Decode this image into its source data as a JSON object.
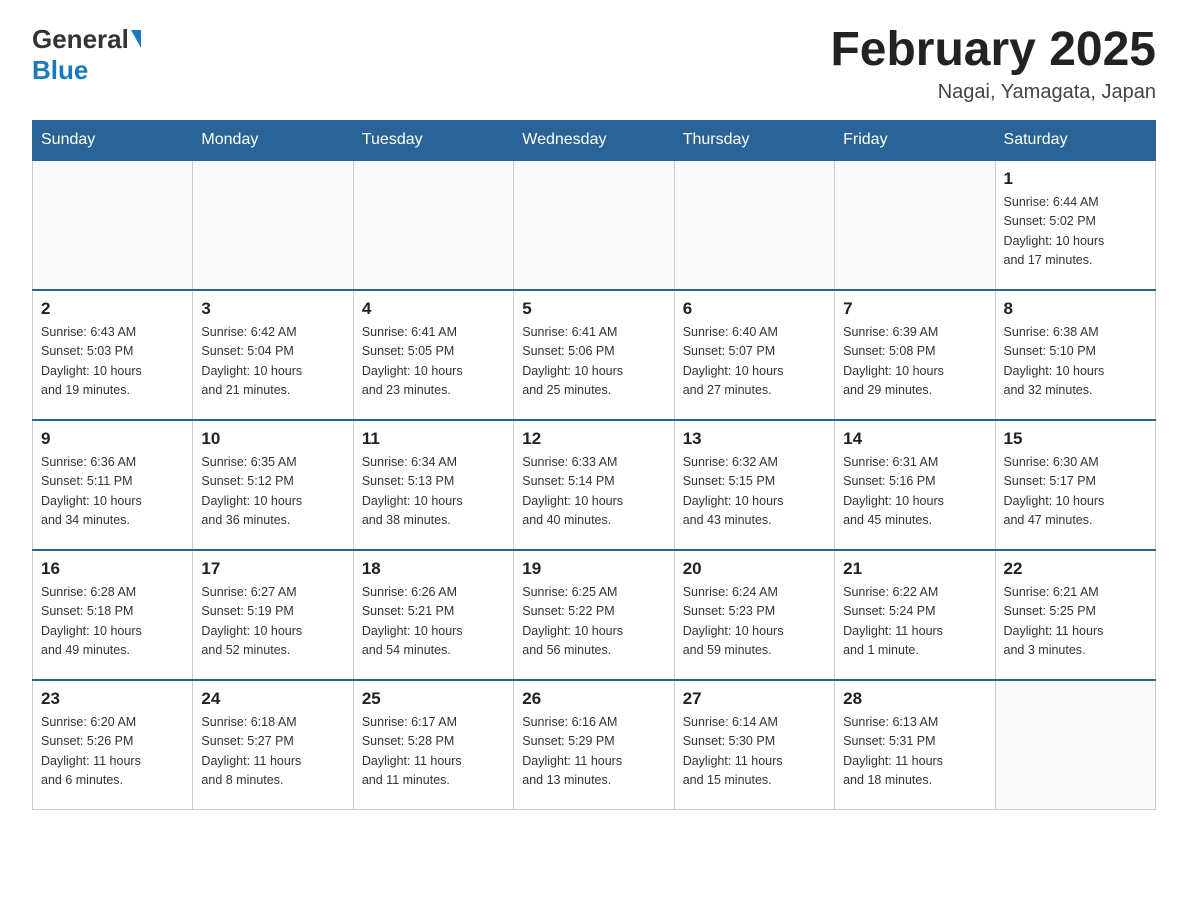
{
  "logo": {
    "general": "General",
    "blue": "Blue"
  },
  "header": {
    "title": "February 2025",
    "location": "Nagai, Yamagata, Japan"
  },
  "weekdays": [
    "Sunday",
    "Monday",
    "Tuesday",
    "Wednesday",
    "Thursday",
    "Friday",
    "Saturday"
  ],
  "weeks": [
    [
      {
        "day": "",
        "info": ""
      },
      {
        "day": "",
        "info": ""
      },
      {
        "day": "",
        "info": ""
      },
      {
        "day": "",
        "info": ""
      },
      {
        "day": "",
        "info": ""
      },
      {
        "day": "",
        "info": ""
      },
      {
        "day": "1",
        "info": "Sunrise: 6:44 AM\nSunset: 5:02 PM\nDaylight: 10 hours\nand 17 minutes."
      }
    ],
    [
      {
        "day": "2",
        "info": "Sunrise: 6:43 AM\nSunset: 5:03 PM\nDaylight: 10 hours\nand 19 minutes."
      },
      {
        "day": "3",
        "info": "Sunrise: 6:42 AM\nSunset: 5:04 PM\nDaylight: 10 hours\nand 21 minutes."
      },
      {
        "day": "4",
        "info": "Sunrise: 6:41 AM\nSunset: 5:05 PM\nDaylight: 10 hours\nand 23 minutes."
      },
      {
        "day": "5",
        "info": "Sunrise: 6:41 AM\nSunset: 5:06 PM\nDaylight: 10 hours\nand 25 minutes."
      },
      {
        "day": "6",
        "info": "Sunrise: 6:40 AM\nSunset: 5:07 PM\nDaylight: 10 hours\nand 27 minutes."
      },
      {
        "day": "7",
        "info": "Sunrise: 6:39 AM\nSunset: 5:08 PM\nDaylight: 10 hours\nand 29 minutes."
      },
      {
        "day": "8",
        "info": "Sunrise: 6:38 AM\nSunset: 5:10 PM\nDaylight: 10 hours\nand 32 minutes."
      }
    ],
    [
      {
        "day": "9",
        "info": "Sunrise: 6:36 AM\nSunset: 5:11 PM\nDaylight: 10 hours\nand 34 minutes."
      },
      {
        "day": "10",
        "info": "Sunrise: 6:35 AM\nSunset: 5:12 PM\nDaylight: 10 hours\nand 36 minutes."
      },
      {
        "day": "11",
        "info": "Sunrise: 6:34 AM\nSunset: 5:13 PM\nDaylight: 10 hours\nand 38 minutes."
      },
      {
        "day": "12",
        "info": "Sunrise: 6:33 AM\nSunset: 5:14 PM\nDaylight: 10 hours\nand 40 minutes."
      },
      {
        "day": "13",
        "info": "Sunrise: 6:32 AM\nSunset: 5:15 PM\nDaylight: 10 hours\nand 43 minutes."
      },
      {
        "day": "14",
        "info": "Sunrise: 6:31 AM\nSunset: 5:16 PM\nDaylight: 10 hours\nand 45 minutes."
      },
      {
        "day": "15",
        "info": "Sunrise: 6:30 AM\nSunset: 5:17 PM\nDaylight: 10 hours\nand 47 minutes."
      }
    ],
    [
      {
        "day": "16",
        "info": "Sunrise: 6:28 AM\nSunset: 5:18 PM\nDaylight: 10 hours\nand 49 minutes."
      },
      {
        "day": "17",
        "info": "Sunrise: 6:27 AM\nSunset: 5:19 PM\nDaylight: 10 hours\nand 52 minutes."
      },
      {
        "day": "18",
        "info": "Sunrise: 6:26 AM\nSunset: 5:21 PM\nDaylight: 10 hours\nand 54 minutes."
      },
      {
        "day": "19",
        "info": "Sunrise: 6:25 AM\nSunset: 5:22 PM\nDaylight: 10 hours\nand 56 minutes."
      },
      {
        "day": "20",
        "info": "Sunrise: 6:24 AM\nSunset: 5:23 PM\nDaylight: 10 hours\nand 59 minutes."
      },
      {
        "day": "21",
        "info": "Sunrise: 6:22 AM\nSunset: 5:24 PM\nDaylight: 11 hours\nand 1 minute."
      },
      {
        "day": "22",
        "info": "Sunrise: 6:21 AM\nSunset: 5:25 PM\nDaylight: 11 hours\nand 3 minutes."
      }
    ],
    [
      {
        "day": "23",
        "info": "Sunrise: 6:20 AM\nSunset: 5:26 PM\nDaylight: 11 hours\nand 6 minutes."
      },
      {
        "day": "24",
        "info": "Sunrise: 6:18 AM\nSunset: 5:27 PM\nDaylight: 11 hours\nand 8 minutes."
      },
      {
        "day": "25",
        "info": "Sunrise: 6:17 AM\nSunset: 5:28 PM\nDaylight: 11 hours\nand 11 minutes."
      },
      {
        "day": "26",
        "info": "Sunrise: 6:16 AM\nSunset: 5:29 PM\nDaylight: 11 hours\nand 13 minutes."
      },
      {
        "day": "27",
        "info": "Sunrise: 6:14 AM\nSunset: 5:30 PM\nDaylight: 11 hours\nand 15 minutes."
      },
      {
        "day": "28",
        "info": "Sunrise: 6:13 AM\nSunset: 5:31 PM\nDaylight: 11 hours\nand 18 minutes."
      },
      {
        "day": "",
        "info": ""
      }
    ]
  ]
}
